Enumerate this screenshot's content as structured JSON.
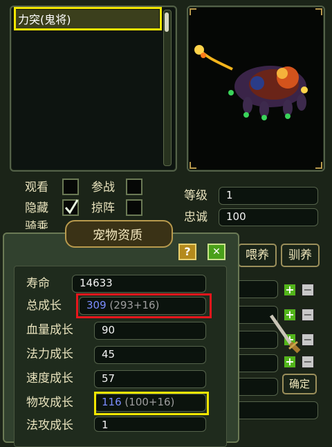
{
  "pet_list": {
    "selected_pet": "力突(鬼将)"
  },
  "right_panel": {
    "checkboxes": [
      {
        "label": "观看",
        "checked": false
      },
      {
        "label": "参战",
        "checked": false
      },
      {
        "label": "隐藏",
        "checked": true
      },
      {
        "label": "掠阵",
        "checked": false
      },
      {
        "label": "骑乘",
        "checked": false
      }
    ],
    "stats": [
      {
        "label": "等级",
        "value": "1"
      },
      {
        "label": "忠诚",
        "value": "100"
      }
    ],
    "buttons": {
      "feed": "喂养",
      "train": "驯养",
      "confirm": "确定"
    }
  },
  "quality_dialog": {
    "title": "宠物资质",
    "help_label": "?",
    "close_label": "✕",
    "rows": [
      {
        "label": "寿命",
        "value": "14633",
        "extra": ""
      },
      {
        "label": "总成长",
        "value": "309",
        "extra": "(293+16)"
      },
      {
        "label": "血量成长",
        "value": "90",
        "extra": ""
      },
      {
        "label": "法力成长",
        "value": "45",
        "extra": ""
      },
      {
        "label": "速度成长",
        "value": "57",
        "extra": ""
      },
      {
        "label": "物攻成长",
        "value": "116",
        "extra": "(100+16)"
      },
      {
        "label": "法攻成长",
        "value": "1",
        "extra": ""
      }
    ]
  },
  "highlights": {
    "yellow": "#f2e600",
    "red": "#e8161c"
  }
}
